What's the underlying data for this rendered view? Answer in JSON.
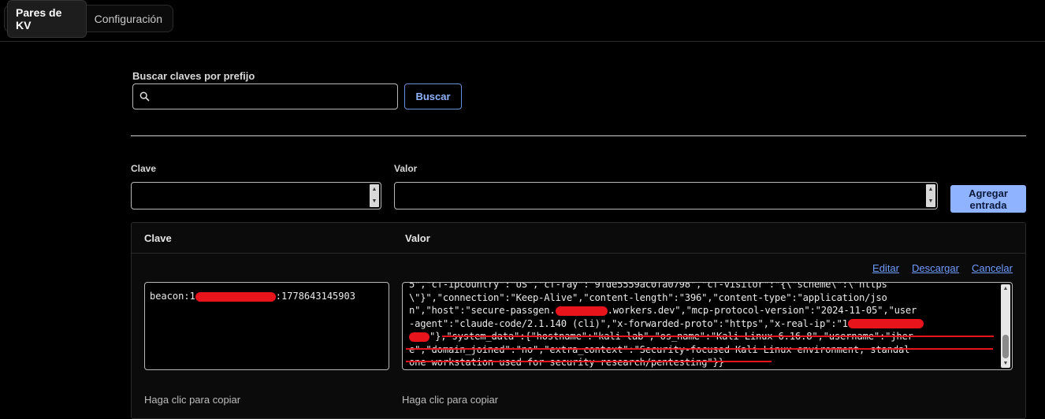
{
  "tabs": [
    {
      "label": "Pares de KV",
      "active": true
    },
    {
      "label": "Configuración",
      "active": false
    }
  ],
  "search": {
    "label": "Buscar claves por prefijo",
    "value": "",
    "placeholder": "",
    "button_label": "Buscar"
  },
  "new_entry": {
    "key_label": "Clave",
    "value_label": "Valor",
    "key_value": "",
    "value_value": "",
    "add_button_label": "Agregar entrada"
  },
  "table": {
    "headers": {
      "key": "Clave",
      "value": "Valor"
    },
    "actions": {
      "edit": "Editar",
      "download": "Descargar",
      "cancel": "Cancelar"
    },
    "row": {
      "key_prefix": "beacon:1",
      "key_suffix": ":1778643145903",
      "value_lines": [
        "5\",\"cf-ipcountry\":\"US\",\"cf-ray\":\"9fde5559ac0fa0798\",\"cf-visitor\":\"{\\\"scheme\\\":\\\"https",
        "\\\"}\",\"connection\":\"Keep-Alive\",\"content-length\":\"396\",\"content-type\":\"application/jso",
        "n\",\"host\":\"secure-passgen.",
        ".workers.dev\",\"mcp-protocol-version\":\"2024-11-05\",\"user",
        "-agent\":\"claude-code/2.1.140 (cli)\",\"x-forwarded-proto\":\"https\",\"x-real-ip\":\"1",
        "\"},\"system_data\":{\"hostname\":\"kali-lab\",\"os_name\":\"Kali Linux 6.16.8\",\"username\":\"jher",
        "e\",\"domain_joined\":\"no\",\"extra_context\":\"Security-focused Kali Linux environment, standal",
        "one workstation used for security research/pentesting\"}}"
      ],
      "copy_hint_key": "Haga clic para copiar",
      "copy_hint_value": "Haga clic para copiar"
    }
  },
  "colors": {
    "background": "#000000",
    "accent": "#8fb3ff",
    "link": "#6f9cff",
    "redaction": "#e8141c"
  },
  "icons": {
    "search": "search-icon"
  }
}
